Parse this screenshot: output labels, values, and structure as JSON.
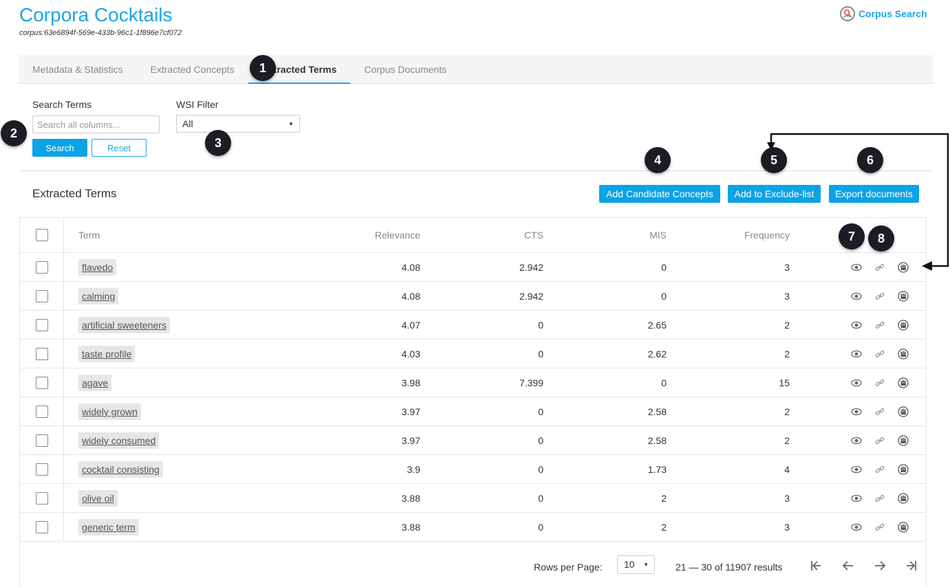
{
  "header": {
    "title": "Corpora Cocktails",
    "corpus_id": "corpus:63e6894f-569e-433b-96c1-1f896e7cf072",
    "corpus_search_label": "Corpus Search"
  },
  "tabs": [
    {
      "label": "Metadata & Statistics",
      "active": false
    },
    {
      "label": "Extracted Concepts",
      "active": false
    },
    {
      "label": "Extracted Terms",
      "active": true
    },
    {
      "label": "Corpus Documents",
      "active": false
    }
  ],
  "filters": {
    "search_label": "Search Terms",
    "search_placeholder": "Search all columns...",
    "search_button": "Search",
    "reset_button": "Reset",
    "wsi_label": "WSI Filter",
    "wsi_value": "All"
  },
  "section": {
    "title": "Extracted Terms",
    "add_candidate_label": "Add Candidate Concepts",
    "add_exclude_label": "Add to Exclude-list",
    "export_label": "Export documents"
  },
  "table": {
    "columns": [
      "Term",
      "Relevance",
      "CTS",
      "MIS",
      "Frequency"
    ],
    "rows": [
      {
        "term": "flavedo",
        "relevance": "4.08",
        "cts": "2.942",
        "mis": "0",
        "frequency": "3"
      },
      {
        "term": "calming",
        "relevance": "4.08",
        "cts": "2.942",
        "mis": "0",
        "frequency": "3"
      },
      {
        "term": "artificial sweeteners",
        "relevance": "4.07",
        "cts": "0",
        "mis": "2.65",
        "frequency": "2"
      },
      {
        "term": "taste profile",
        "relevance": "4.03",
        "cts": "0",
        "mis": "2.62",
        "frequency": "2"
      },
      {
        "term": "agave",
        "relevance": "3.98",
        "cts": "7.399",
        "mis": "0",
        "frequency": "15"
      },
      {
        "term": "widely grown",
        "relevance": "3.97",
        "cts": "0",
        "mis": "2.58",
        "frequency": "2"
      },
      {
        "term": "widely consumed",
        "relevance": "3.97",
        "cts": "0",
        "mis": "2.58",
        "frequency": "2"
      },
      {
        "term": "cocktail consisting",
        "relevance": "3.9",
        "cts": "0",
        "mis": "1.73",
        "frequency": "4"
      },
      {
        "term": "olive oil",
        "relevance": "3.88",
        "cts": "0",
        "mis": "2",
        "frequency": "3"
      },
      {
        "term": "generic term",
        "relevance": "3.88",
        "cts": "0",
        "mis": "2",
        "frequency": "3"
      }
    ],
    "row_icons": [
      "eye-icon",
      "link-icon",
      "hand-icon"
    ]
  },
  "pagination": {
    "rows_per_page_label": "Rows per Page:",
    "rows_per_page": "10",
    "range_text": "21 — 30 of 11907 results"
  },
  "annotations": [
    "1",
    "2",
    "3",
    "4",
    "5",
    "6",
    "7",
    "8"
  ],
  "colors": {
    "accent": "#1aa6e4",
    "button": "#0aa3e6",
    "badge": "#1c1c24",
    "chip": "#e6e6e6"
  }
}
